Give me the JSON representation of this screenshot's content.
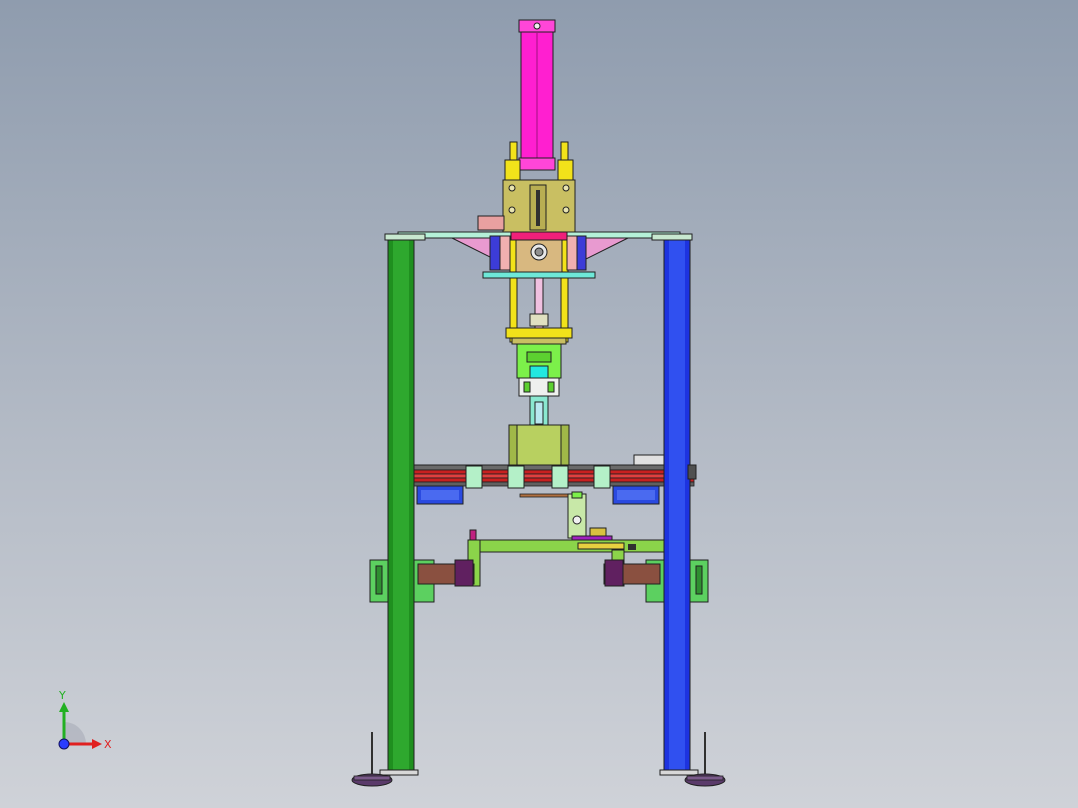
{
  "viewport": {
    "background_top": "#8f9cae",
    "background_bottom": "#cfd2d8"
  },
  "triad": {
    "x_label": "X",
    "y_label": "Y",
    "x_color": "#e02020",
    "y_color": "#22b022",
    "origin_color": "#2a3cff"
  },
  "model_colors": {
    "cylinder": "#ff1fd0",
    "guide_rods": "#f2e21a",
    "left_column": "#1f8f1f",
    "right_column": "#1d33e0",
    "head_block": "#c9bf62",
    "gripper": "#7cf04a",
    "rail": "#c82020",
    "lower_frame": "#8bd44a",
    "roller": "#b8d060"
  }
}
